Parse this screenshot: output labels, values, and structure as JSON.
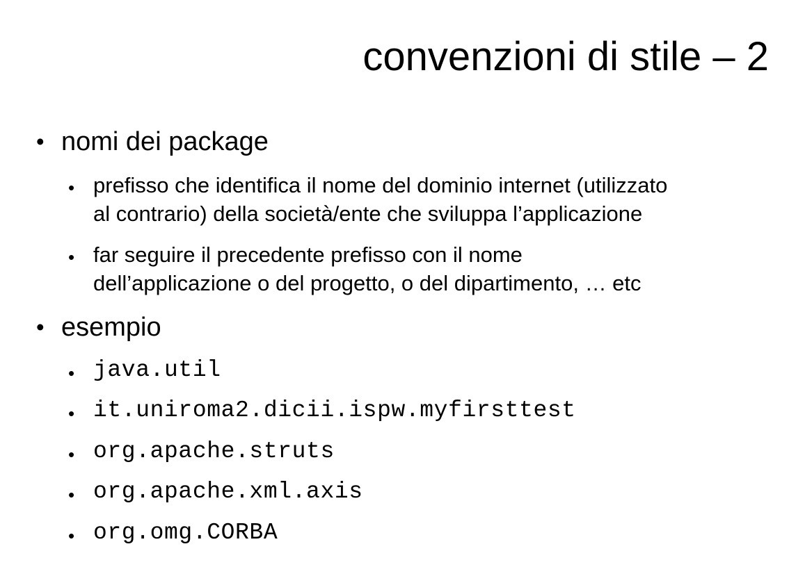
{
  "slide": {
    "title": "convenzioni di stile – 2",
    "bullet_symbol": "•",
    "sections": [
      {
        "label": "nomi dei package",
        "items": [
          {
            "line1": "prefisso che identifica il nome del dominio internet (utilizzato",
            "line2": "al contrario) della società/ente che sviluppa l’applicazione"
          },
          {
            "line1": "far seguire il precedente prefisso con il nome",
            "line2": "dell’applicazione o del progetto, o del dipartimento, … etc"
          }
        ]
      },
      {
        "label": "esempio",
        "items": [
          "java.util",
          "it.uniroma2.dicii.ispw.myfirsttest",
          "org.apache.struts",
          "org.apache.xml.axis",
          "org.omg.CORBA"
        ]
      }
    ]
  }
}
